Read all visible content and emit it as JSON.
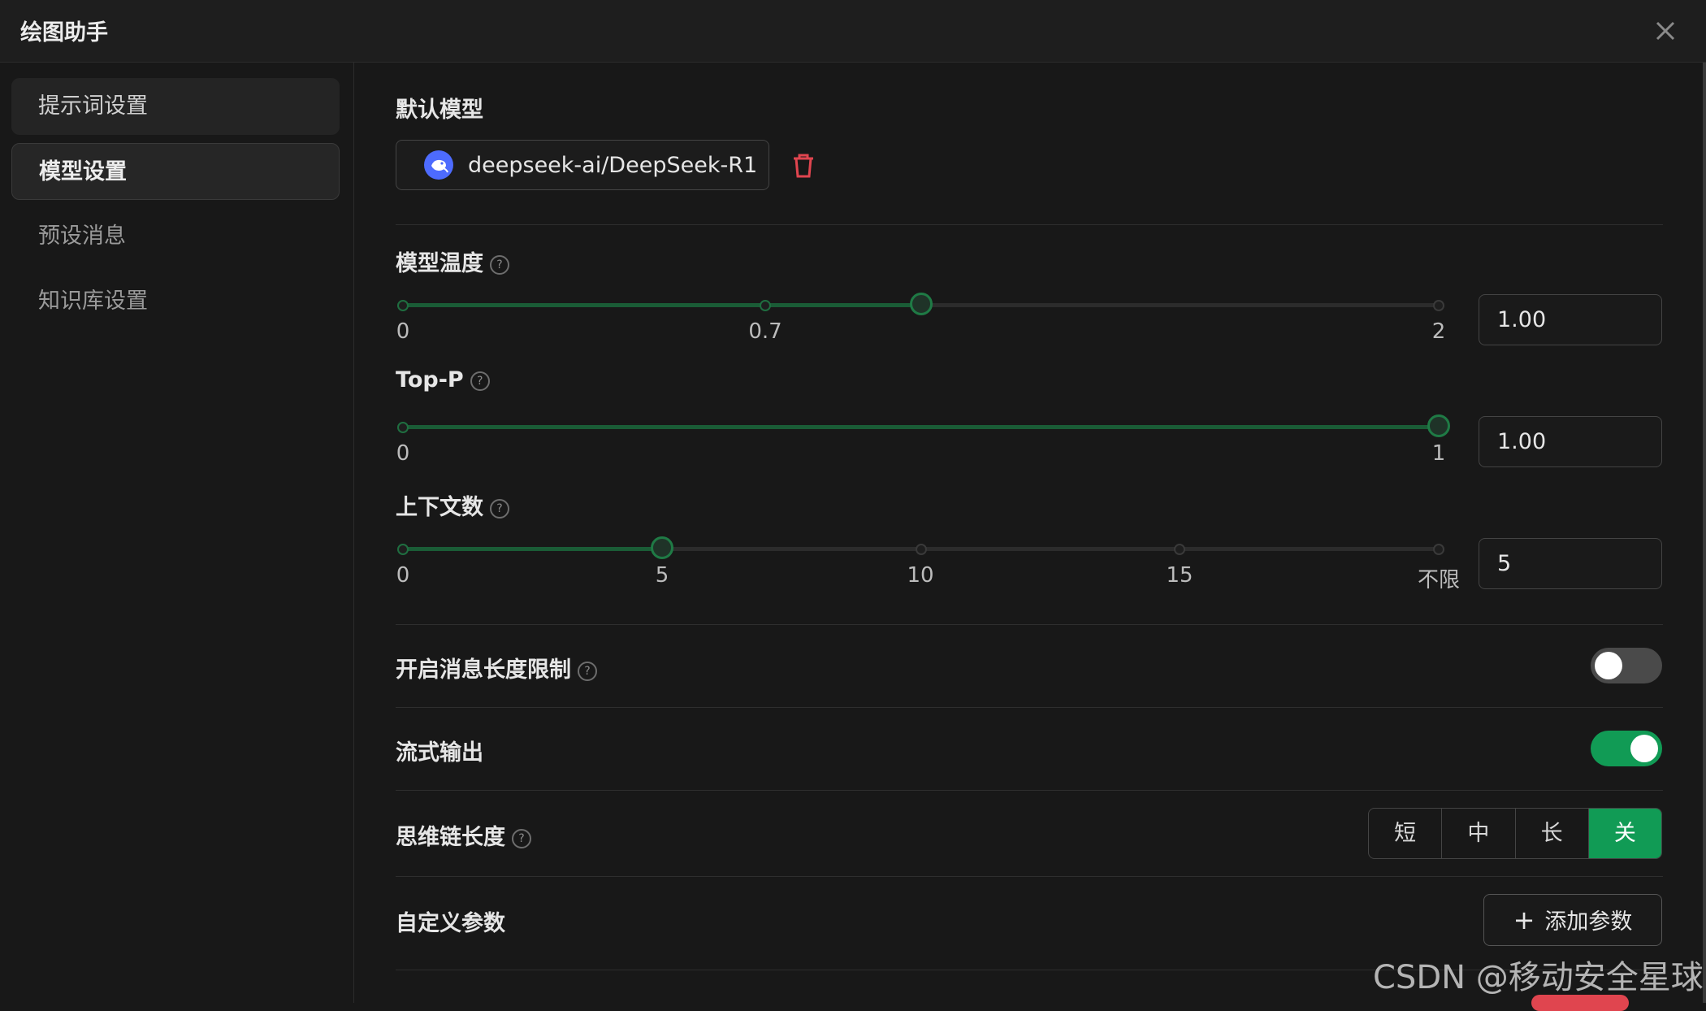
{
  "window": {
    "title": "绘图助手"
  },
  "sidebar": {
    "items": [
      {
        "label": "提示词设置"
      },
      {
        "label": "模型设置"
      },
      {
        "label": "预设消息"
      },
      {
        "label": "知识库设置"
      }
    ],
    "active_index": 1
  },
  "default_model": {
    "label": "默认模型",
    "name": "deepseek-ai/DeepSeek-R1"
  },
  "temperature": {
    "label": "模型温度",
    "ticks": [
      "0",
      "0.7",
      "2"
    ],
    "value": "1.00",
    "min": 0,
    "max": 2,
    "current": 1.0
  },
  "top_p": {
    "label": "Top-P",
    "ticks": [
      "0",
      "1"
    ],
    "value": "1.00",
    "min": 0,
    "max": 1,
    "current": 1.0
  },
  "context_count": {
    "label": "上下文数",
    "ticks": [
      "0",
      "5",
      "10",
      "15",
      "不限"
    ],
    "value": "5",
    "current_step": 1,
    "steps": 4
  },
  "message_length_limit": {
    "label": "开启消息长度限制",
    "enabled": false
  },
  "stream_output": {
    "label": "流式输出",
    "enabled": true
  },
  "chain_of_thought": {
    "label": "思维链长度",
    "options": [
      "短",
      "中",
      "长",
      "关"
    ],
    "selected": "关"
  },
  "custom_params": {
    "label": "自定义参数",
    "add_button": "添加参数"
  },
  "watermark": "CSDN @移动安全星球",
  "colors": {
    "accent": "#119b55",
    "slider_fill": "#1a5c36",
    "delete": "#e0454f",
    "model_avatar": "#4d6bfe"
  }
}
